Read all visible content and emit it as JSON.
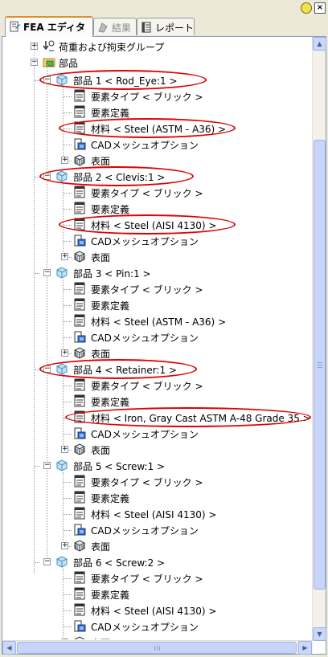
{
  "tabs": [
    {
      "label": "FEA エディタ",
      "icon": "fea-editor-icon",
      "active": true
    },
    {
      "label": "結果",
      "icon": "results-icon",
      "active": false
    },
    {
      "label": "レポート",
      "icon": "report-icon",
      "active": false
    }
  ],
  "tree": {
    "loads_group": "荷重および拘束グループ",
    "parts_root": "部品",
    "parts": [
      {
        "label": "部品 1 < Rod_Eye:1 >",
        "element_type": "要素タイプ < ブリック >",
        "element_def": "要素定義",
        "material": "材料 < Steel (ASTM - A36) >",
        "cad_mesh": "CADメッシュオプション",
        "surface": "表面"
      },
      {
        "label": "部品 2 < Clevis:1 >",
        "element_type": "要素タイプ < ブリック >",
        "element_def": "要素定義",
        "material": "材料 < Steel (AISI 4130) >",
        "cad_mesh": "CADメッシュオプション",
        "surface": "表面"
      },
      {
        "label": "部品 3 < Pin:1 >",
        "element_type": "要素タイプ < ブリック >",
        "element_def": "要素定義",
        "material": "材料 < Steel (ASTM - A36) >",
        "cad_mesh": "CADメッシュオプション",
        "surface": "表面"
      },
      {
        "label": "部品 4 < Retainer:1 >",
        "element_type": "要素タイプ < ブリック >",
        "element_def": "要素定義",
        "material": "材料 < Iron, Gray Cast ASTM A-48 Grade 35 >",
        "cad_mesh": "CADメッシュオプション",
        "surface": "表面"
      },
      {
        "label": "部品 5 < Screw:1 >",
        "element_type": "要素タイプ < ブリック >",
        "element_def": "要素定義",
        "material": "材料 < Steel (AISI 4130) >",
        "cad_mesh": "CADメッシュオプション",
        "surface": "表面"
      },
      {
        "label": "部品 6 < Screw:2 >",
        "element_type": "要素タイプ < ブリック >",
        "element_def": "要素定義",
        "material": "材料 < Steel (AISI 4130) >",
        "cad_mesh": "CADメッシュオプション",
        "surface": "表面"
      }
    ]
  },
  "colors": {
    "highlight_ring": "#e00000",
    "tab_accent": "#e68b2c"
  }
}
